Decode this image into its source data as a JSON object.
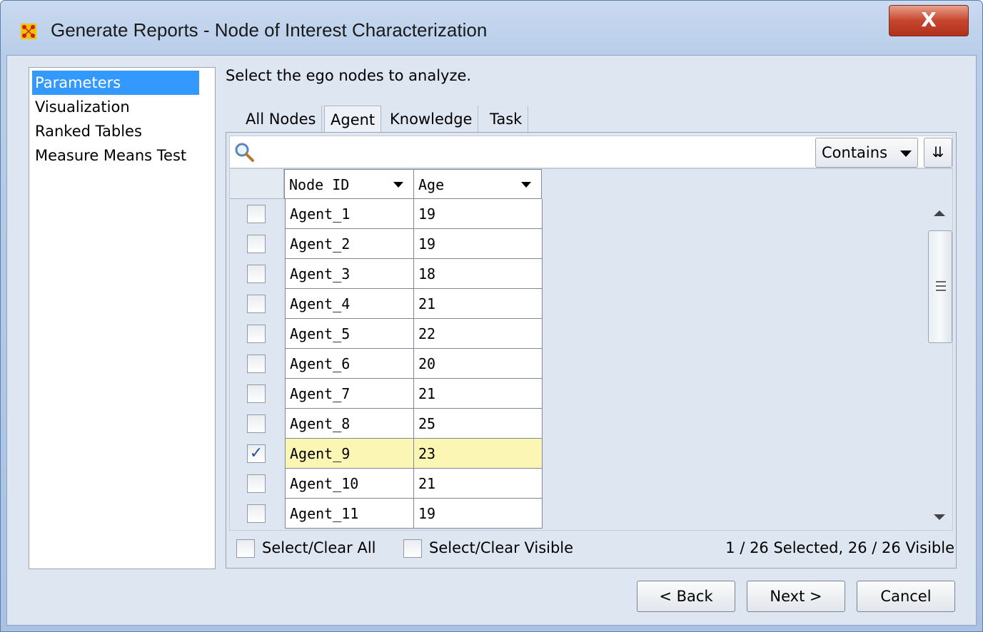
{
  "window": {
    "title": "Generate Reports - Node of Interest Characterization",
    "close_label": "X"
  },
  "sidebar": {
    "items": [
      {
        "label": "Parameters",
        "selected": true
      },
      {
        "label": "Visualization",
        "selected": false
      },
      {
        "label": "Ranked Tables",
        "selected": false
      },
      {
        "label": "Measure Means Test",
        "selected": false
      }
    ]
  },
  "main": {
    "instruction": "Select the ego nodes to analyze.",
    "tabs": [
      {
        "label": "All Nodes",
        "active": false
      },
      {
        "label": "Agent",
        "active": true
      },
      {
        "label": "Knowledge",
        "active": false
      },
      {
        "label": "Task",
        "active": false
      }
    ],
    "search": {
      "value": "",
      "filter_mode": "Contains",
      "expand_label": "»"
    },
    "table": {
      "columns": [
        "Node ID",
        "Age"
      ],
      "rows": [
        {
          "node_id": "Agent_1",
          "age": "19",
          "checked": false
        },
        {
          "node_id": "Agent_2",
          "age": "19",
          "checked": false
        },
        {
          "node_id": "Agent_3",
          "age": "18",
          "checked": false
        },
        {
          "node_id": "Agent_4",
          "age": "21",
          "checked": false
        },
        {
          "node_id": "Agent_5",
          "age": "22",
          "checked": false
        },
        {
          "node_id": "Agent_6",
          "age": "20",
          "checked": false
        },
        {
          "node_id": "Agent_7",
          "age": "21",
          "checked": false
        },
        {
          "node_id": "Agent_8",
          "age": "25",
          "checked": false
        },
        {
          "node_id": "Agent_9",
          "age": "23",
          "checked": true
        },
        {
          "node_id": "Agent_10",
          "age": "21",
          "checked": false
        },
        {
          "node_id": "Agent_11",
          "age": "19",
          "checked": false
        }
      ]
    },
    "select_all_label": "Select/Clear All",
    "select_visible_label": "Select/Clear Visible",
    "status": "1 / 26 Selected, 26 / 26 Visible"
  },
  "buttons": {
    "back": "< Back",
    "next": "Next >",
    "cancel": "Cancel"
  },
  "colors": {
    "selection": "#3399ff",
    "highlight_row": "#fbf6b3",
    "close_button": "#c7452d"
  }
}
